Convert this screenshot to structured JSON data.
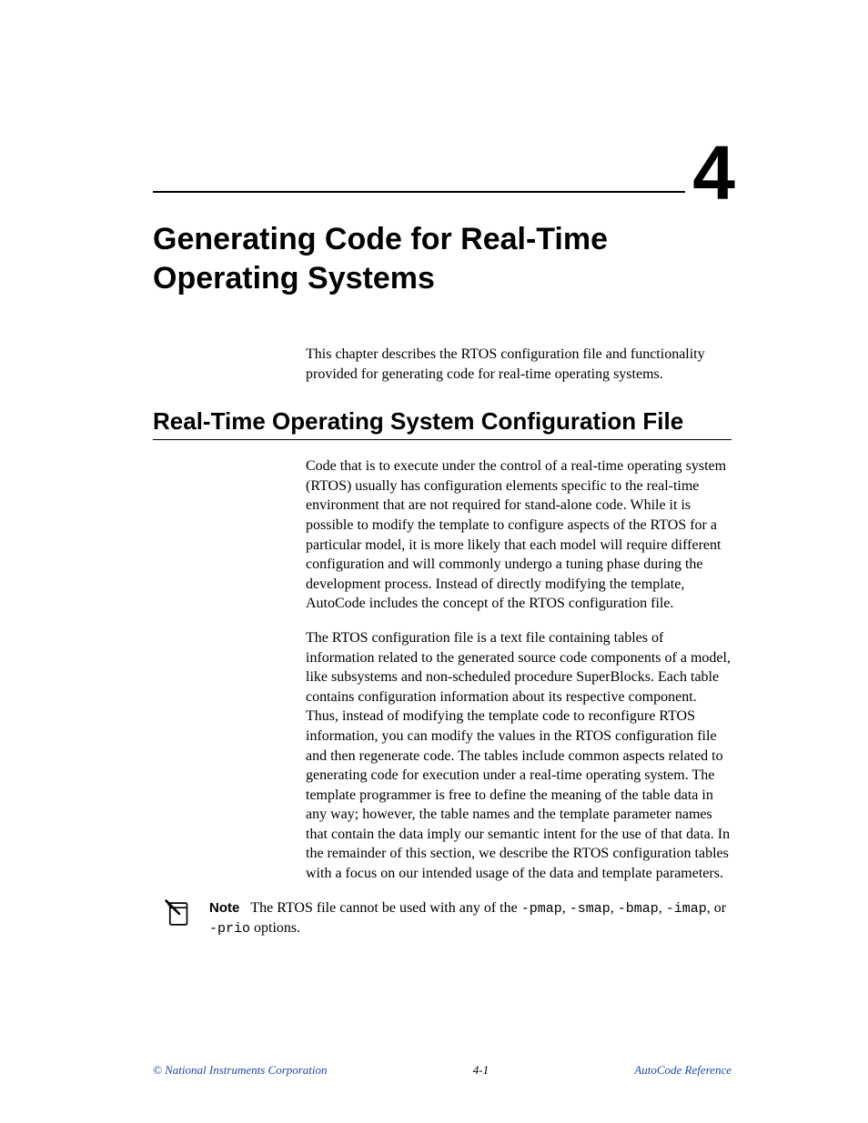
{
  "chapter": {
    "number": "4",
    "title": "Generating Code for Real-Time Operating Systems"
  },
  "intro": "This chapter describes the RTOS configuration file and functionality provided for generating code for real-time operating systems.",
  "section": {
    "heading": "Real-Time Operating System Configuration File",
    "para1": "Code that is to execute under the control of a real-time operating system (RTOS) usually has configuration elements specific to the real-time environment that are not required for stand-alone code. While it is possible to modify the template to configure aspects of the RTOS for a particular model, it is more likely that each model will require different configuration and will commonly undergo a tuning phase during the development process. Instead of directly modifying the template, AutoCode includes the concept of the RTOS configuration file.",
    "para2": "The RTOS configuration file is a text file containing tables of information related to the generated source code components of a model, like subsystems and non-scheduled procedure SuperBlocks. Each table contains configuration information about its respective component. Thus, instead of modifying the template code to reconfigure RTOS information, you can modify the values in the RTOS configuration file and then regenerate code. The tables include common aspects related to generating code for execution under a real-time operating system. The template programmer is free to define the meaning of the table data in any way; however, the table names and the template parameter names that contain the data imply our semantic intent for the use of that data. In the remainder of this section, we describe the RTOS configuration tables with a focus on our intended usage of the data and template parameters."
  },
  "note": {
    "label": "Note",
    "pre": "The RTOS file cannot be used with any of the ",
    "opts": [
      "-pmap",
      "-smap",
      "-bmap",
      "-imap"
    ],
    "mid": ", or ",
    "last_opt": "-prio",
    "post": " options."
  },
  "footer": {
    "left": "© National Instruments Corporation",
    "center": "4-1",
    "right": "AutoCode Reference"
  }
}
